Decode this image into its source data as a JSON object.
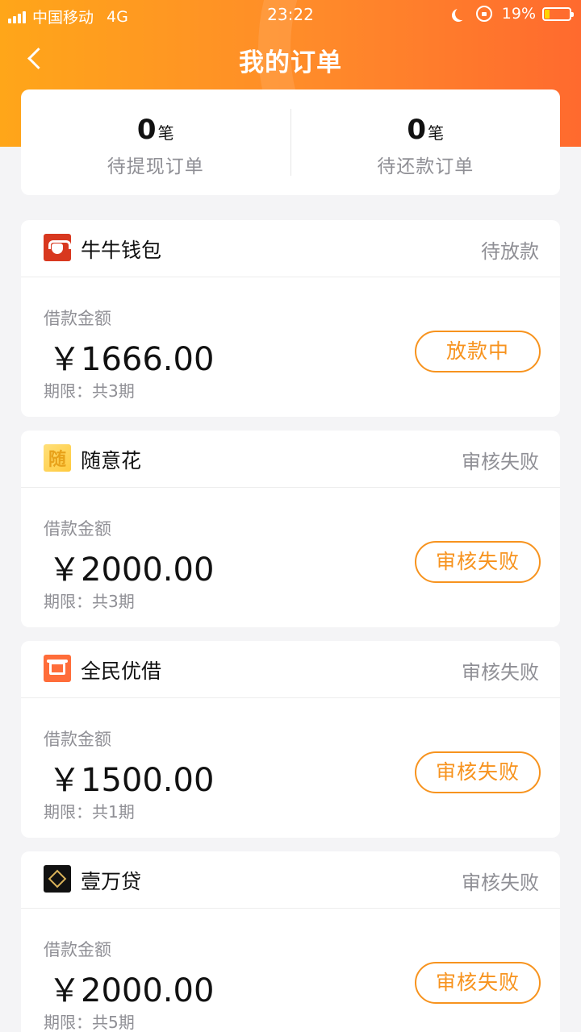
{
  "status_bar": {
    "carrier": "中国移动",
    "network": "4G",
    "time": "23:22",
    "battery": "19%",
    "battery_fraction": 0.19
  },
  "nav": {
    "title": "我的订单"
  },
  "summary": [
    {
      "count": "0",
      "unit": "笔",
      "label": "待提现订单"
    },
    {
      "count": "0",
      "unit": "笔",
      "label": "待还款订单"
    }
  ],
  "orders": [
    {
      "lender": "牛牛钱包",
      "logo": "bull-logo-icon",
      "status": "待放款",
      "amount_label": "借款金额",
      "amount": "￥1666.00",
      "term": "期限：共3期",
      "action": "放款中"
    },
    {
      "lender": "随意花",
      "logo": "sui-logo-icon",
      "logo_char": "随",
      "status": "审核失败",
      "amount_label": "借款金额",
      "amount": "￥2000.00",
      "term": "期限：共3期",
      "action": "审核失败"
    },
    {
      "lender": "全民优借",
      "logo": "box-logo-icon",
      "status": "审核失败",
      "amount_label": "借款金额",
      "amount": "￥1500.00",
      "term": "期限：共1期",
      "action": "审核失败"
    },
    {
      "lender": "壹万贷",
      "logo": "diamond-logo-icon",
      "status": "审核失败",
      "amount_label": "借款金额",
      "amount": "￥2000.00",
      "term": "期限：共5期",
      "action": "审核失败"
    }
  ],
  "colors": {
    "header_start": "#ffa619",
    "header_end": "#ff6a2e",
    "accent": "#f7931e",
    "muted_text": "#8f8f95",
    "background": "#f4f4f6"
  }
}
